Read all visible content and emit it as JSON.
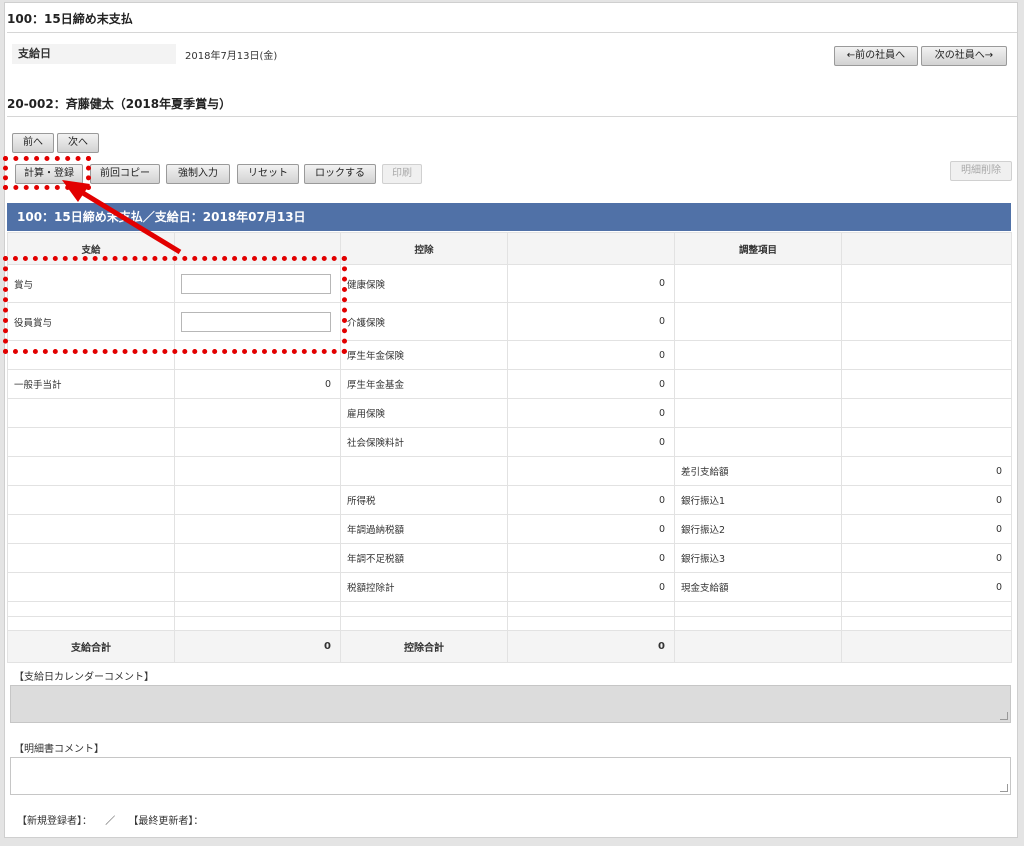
{
  "section_title": "100：15日締め末支払",
  "pay_date": {
    "label": "支給日",
    "value": "2018年7月13日(金)"
  },
  "employee_nav": {
    "prev": "←前の社員へ",
    "next": "次の社員へ→"
  },
  "employee_title": "20-002：斉藤健太（2018年夏季賞与）",
  "pager": {
    "prev": "前へ",
    "next": "次へ"
  },
  "toolbar": {
    "calc_register": "計算・登録",
    "copy_previous": "前回コピー",
    "force_input": "強制入力",
    "reset": "リセット",
    "lock": "ロックする",
    "print": "印刷",
    "delete_detail": "明細削除"
  },
  "banner": "100：15日締め末支払／支給日：2018年07月13日",
  "table": {
    "headers": {
      "payment": "支給",
      "deduction": "控除",
      "adjustment": "調整項目"
    },
    "rows": [
      {
        "pay_label": "賞与",
        "pay_input": true,
        "ded_label": "健康保険",
        "ded_value": "0",
        "adj_label": "",
        "adj_value": ""
      },
      {
        "pay_label": "役員賞与",
        "pay_input": true,
        "ded_label": "介護保険",
        "ded_value": "0",
        "adj_label": "",
        "adj_value": ""
      },
      {
        "pay_label": "",
        "pay_value": "",
        "ded_label": "厚生年金保険",
        "ded_value": "0",
        "adj_label": "",
        "adj_value": ""
      },
      {
        "pay_label": "一般手当計",
        "pay_value": "0",
        "ded_label": "厚生年金基金",
        "ded_value": "0",
        "adj_label": "",
        "adj_value": ""
      },
      {
        "pay_label": "",
        "pay_value": "",
        "ded_label": "雇用保険",
        "ded_value": "0",
        "adj_label": "",
        "adj_value": ""
      },
      {
        "pay_label": "",
        "pay_value": "",
        "ded_label": "社会保険料計",
        "ded_value": "0",
        "adj_label": "",
        "adj_value": ""
      },
      {
        "pay_label": "",
        "pay_value": "",
        "ded_label": "",
        "ded_value": "",
        "adj_label": "差引支給額",
        "adj_value": "0"
      },
      {
        "pay_label": "",
        "pay_value": "",
        "ded_label": "所得税",
        "ded_value": "0",
        "adj_label": "銀行振込1",
        "adj_value": "0"
      },
      {
        "pay_label": "",
        "pay_value": "",
        "ded_label": "年調過納税額",
        "ded_value": "0",
        "adj_label": "銀行振込2",
        "adj_value": "0"
      },
      {
        "pay_label": "",
        "pay_value": "",
        "ded_label": "年調不足税額",
        "ded_value": "0",
        "adj_label": "銀行振込3",
        "adj_value": "0"
      },
      {
        "pay_label": "",
        "pay_value": "",
        "ded_label": "税額控除計",
        "ded_value": "0",
        "adj_label": "現金支給額",
        "adj_value": "0"
      }
    ],
    "totals": {
      "pay_label": "支給合計",
      "pay_value": "0",
      "ded_label": "控除合計",
      "ded_value": "0"
    }
  },
  "calendar_comment_label": "【支給日カレンダーコメント】",
  "statement_comment_label": "【明細書コメント】",
  "footer": {
    "registered": "【新規登録者】：",
    "sep": "／",
    "updated": "【最終更新者】："
  },
  "colors": {
    "banner": "#5071a7",
    "annotation": "#e20000"
  }
}
